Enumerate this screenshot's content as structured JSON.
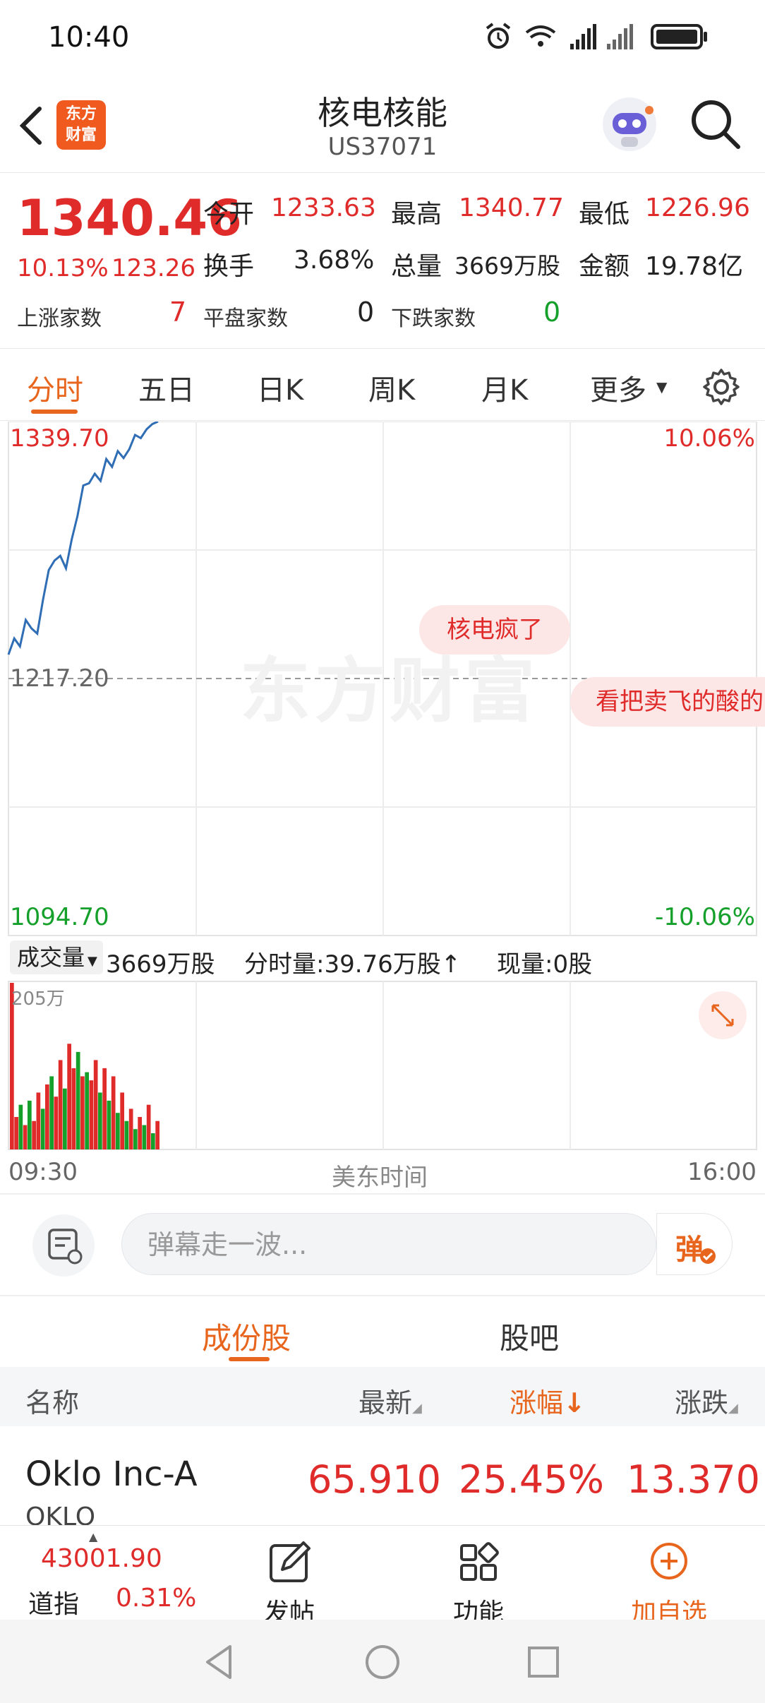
{
  "status_bar": {
    "time": "10:40"
  },
  "header": {
    "logo_line1": "东方",
    "logo_line2": "财富",
    "title": "核电核能",
    "code": "US37071"
  },
  "quote": {
    "price": "1340.46",
    "change_pct": "10.13%",
    "change": "123.26",
    "open_label": "今开",
    "open": "1233.63",
    "high_label": "最高",
    "high": "1340.77",
    "low_label": "最低",
    "low": "1226.96",
    "turnover_label": "换手",
    "turnover": "3.68%",
    "volume_label": "总量",
    "volume": "3669万股",
    "amount_label": "金额",
    "amount": "19.78亿",
    "up_label": "上涨家数",
    "up_count": "7",
    "flat_label": "平盘家数",
    "flat_count": "0",
    "down_label": "下跌家数",
    "down_count": "0"
  },
  "tabs": [
    "分时",
    "五日",
    "日K",
    "周K",
    "月K",
    "更多"
  ],
  "chart": {
    "top_price": "1339.70",
    "top_pct": "10.06%",
    "mid_price": "1217.20",
    "bottom_price": "1094.70",
    "bottom_pct": "-10.06%",
    "watermark": "东方财富",
    "comment1": "核电疯了",
    "comment2": "看把卖飞的酸的"
  },
  "volume": {
    "selector": "成交量",
    "total": "3669万股",
    "minute_vol": "分时量:39.76万股↑",
    "current_vol": "现量:0股",
    "max_label": "205万"
  },
  "time_axis": {
    "start": "09:30",
    "mid": "美东时间",
    "end": "16:00"
  },
  "danmaku": {
    "placeholder": "弹幕走一波...",
    "send_label": "弹"
  },
  "sections": {
    "tab1": "成份股",
    "tab2": "股吧"
  },
  "table": {
    "headers": {
      "name": "名称",
      "latest": "最新",
      "pct": "涨幅",
      "change": "涨跌"
    },
    "rows": [
      {
        "name": "Oklo Inc-A",
        "code": "OKLO",
        "latest": "65.910",
        "pct": "25.45%",
        "change": "13.370"
      }
    ]
  },
  "toolbar": {
    "index_value": "43001.90",
    "index_name": "道指",
    "index_pct": "0.31%",
    "post_label": "发帖",
    "func_label": "功能",
    "add_label": "加自选"
  },
  "colors": {
    "up": "#e02b2b",
    "down": "#14a02a",
    "accent": "#e8651e",
    "line": "#2f6db5"
  },
  "chart_data": {
    "type": "line",
    "price_line": {
      "x_minutes": [
        0,
        3,
        6,
        9,
        12,
        15,
        18,
        21,
        24,
        27,
        30,
        33,
        36,
        39,
        42,
        45,
        48,
        51,
        54,
        57,
        60,
        63,
        66,
        69,
        72,
        75,
        78
      ],
      "y": [
        1228.6,
        1236.3,
        1232.5,
        1245.1,
        1241.1,
        1238.6,
        1254.7,
        1268.9,
        1273.4,
        1275.7,
        1269.7,
        1283.6,
        1294.7,
        1309.2,
        1310.3,
        1314.8,
        1311.4,
        1321.8,
        1318.1,
        1325.6,
        1322.3,
        1326.5,
        1333.3,
        1331.8,
        1336.0,
        1338.5,
        1340.9
      ]
    },
    "volume_bars": {
      "values_wan": [
        205,
        40,
        55,
        30,
        60,
        35,
        70,
        50,
        80,
        90,
        65,
        110,
        75,
        130,
        100,
        120,
        90,
        95,
        85,
        110,
        70,
        100,
        60,
        90,
        45,
        70,
        35,
        50,
        25,
        40,
        30,
        55,
        20,
        35
      ],
      "colors": [
        "r",
        "r",
        "g",
        "r",
        "g",
        "r",
        "r",
        "g",
        "r",
        "g",
        "r",
        "r",
        "g",
        "r",
        "r",
        "g",
        "r",
        "g",
        "r",
        "r",
        "g",
        "r",
        "g",
        "r",
        "g",
        "r",
        "g",
        "r",
        "g",
        "r",
        "g",
        "r",
        "g",
        "r"
      ]
    },
    "ylim": [
      1094.7,
      1339.7
    ],
    "y_mid": 1217.2,
    "x_range": [
      "09:30",
      "16:00"
    ]
  }
}
